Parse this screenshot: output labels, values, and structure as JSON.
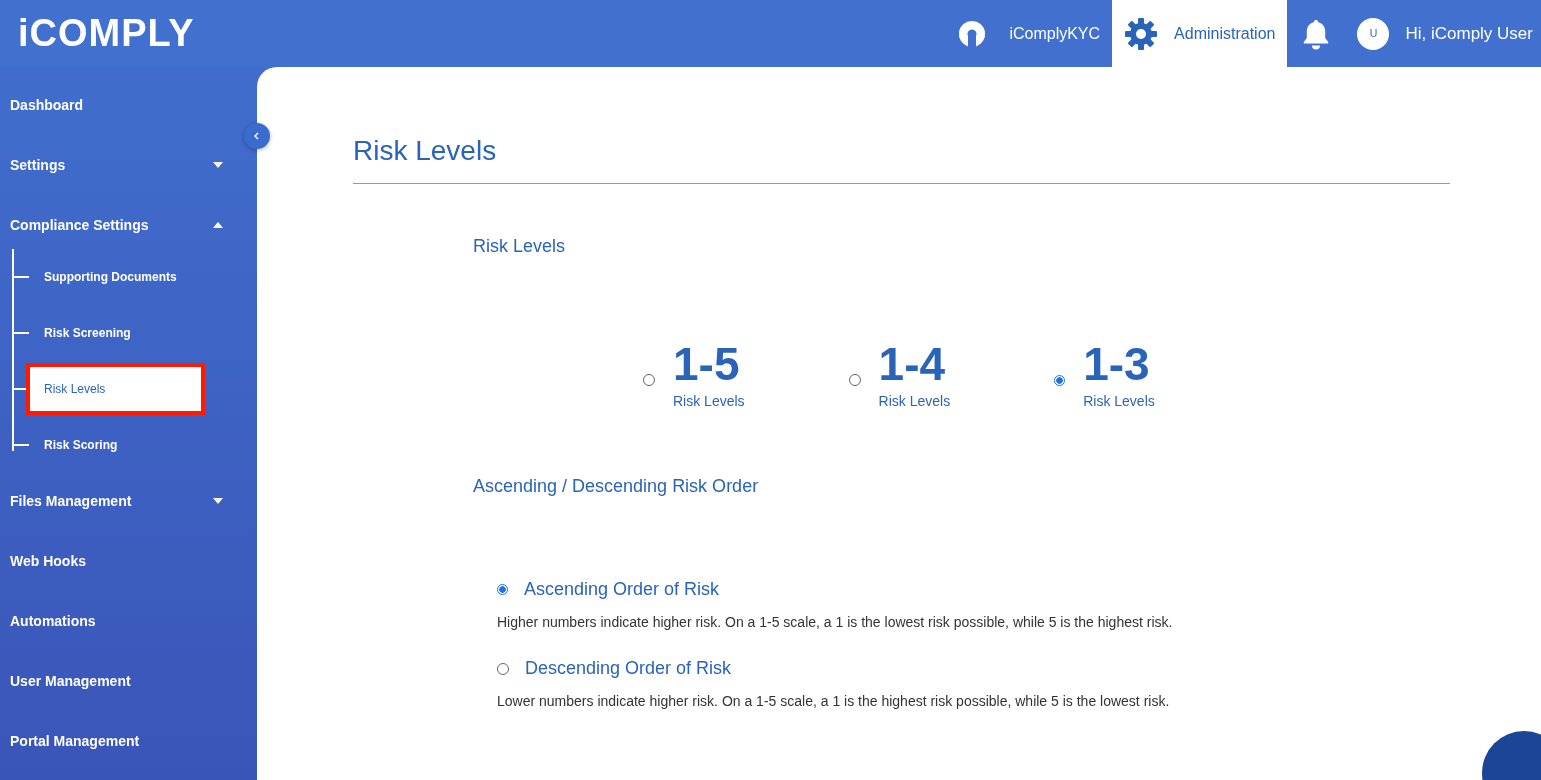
{
  "header": {
    "logo": "iCOMPLY",
    "nav": [
      {
        "label": "iComplyKYC",
        "kind": "keyhole",
        "selected": false
      },
      {
        "label": "Administration",
        "kind": "gear",
        "selected": true
      }
    ],
    "user": {
      "initial": "U",
      "greeting": "Hi, iComply User"
    }
  },
  "sidebar": {
    "items": [
      {
        "label": "Dashboard",
        "selected": false
      },
      {
        "label": "Settings",
        "expanded": false,
        "selected": false
      },
      {
        "label": "Compliance Settings",
        "expanded": true,
        "selected": false,
        "children": [
          {
            "label": "Supporting Documents",
            "selected": false
          },
          {
            "label": "Risk Screening",
            "selected": false
          },
          {
            "label": "Risk Levels",
            "selected": true
          },
          {
            "label": "Risk Scoring",
            "selected": false
          }
        ]
      },
      {
        "label": "Files Management",
        "expanded": false,
        "selected": false
      },
      {
        "label": "Web Hooks",
        "selected": false
      },
      {
        "label": "Automations",
        "selected": false
      },
      {
        "label": "User Management",
        "selected": false
      },
      {
        "label": "Portal Management",
        "selected": false
      }
    ]
  },
  "page": {
    "title": "Risk Levels",
    "levels": {
      "heading": "Risk Levels",
      "options": [
        {
          "value": "1-5",
          "caption": "Risk Levels",
          "selected": false
        },
        {
          "value": "1-4",
          "caption": "Risk Levels",
          "selected": false
        },
        {
          "value": "1-3",
          "caption": "Risk Levels",
          "selected": true
        }
      ]
    },
    "order": {
      "heading": "Ascending / Descending Risk Order",
      "options": [
        {
          "label": "Ascending Order of Risk",
          "description": "Higher numbers indicate higher risk. On a 1-5 scale, a 1 is the lowest risk possible, while 5 is the highest risk.",
          "selected": true
        },
        {
          "label": "Descending Order of Risk",
          "description": "Lower numbers indicate higher risk. On a 1-5 scale, a 1 is the highest risk possible, while 5 is the lowest risk.",
          "selected": false
        }
      ]
    }
  }
}
